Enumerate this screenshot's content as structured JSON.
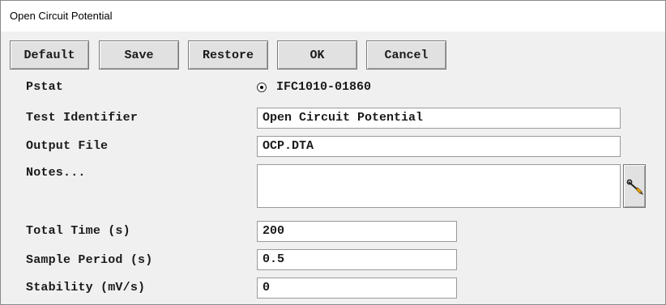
{
  "window": {
    "title": "Open Circuit Potential"
  },
  "toolbar": {
    "default_label": "Default",
    "save_label": "Save",
    "restore_label": "Restore",
    "ok_label": "OK",
    "cancel_label": "Cancel"
  },
  "form": {
    "pstat": {
      "label": "Pstat",
      "option": "IFC1010-01860",
      "selected": true
    },
    "test_identifier": {
      "label": "Test Identifier",
      "value": "Open Circuit Potential"
    },
    "output_file": {
      "label": "Output File",
      "value": "OCP.DTA"
    },
    "notes": {
      "label": "Notes...",
      "value": "",
      "edit_icon": "wrench-pencil-icon"
    },
    "total_time": {
      "label": "Total Time (s)",
      "value": "200"
    },
    "sample_period": {
      "label": "Sample Period (s)",
      "value": "0.5"
    },
    "stability": {
      "label": "Stability (mV/s)",
      "value": "0"
    }
  }
}
